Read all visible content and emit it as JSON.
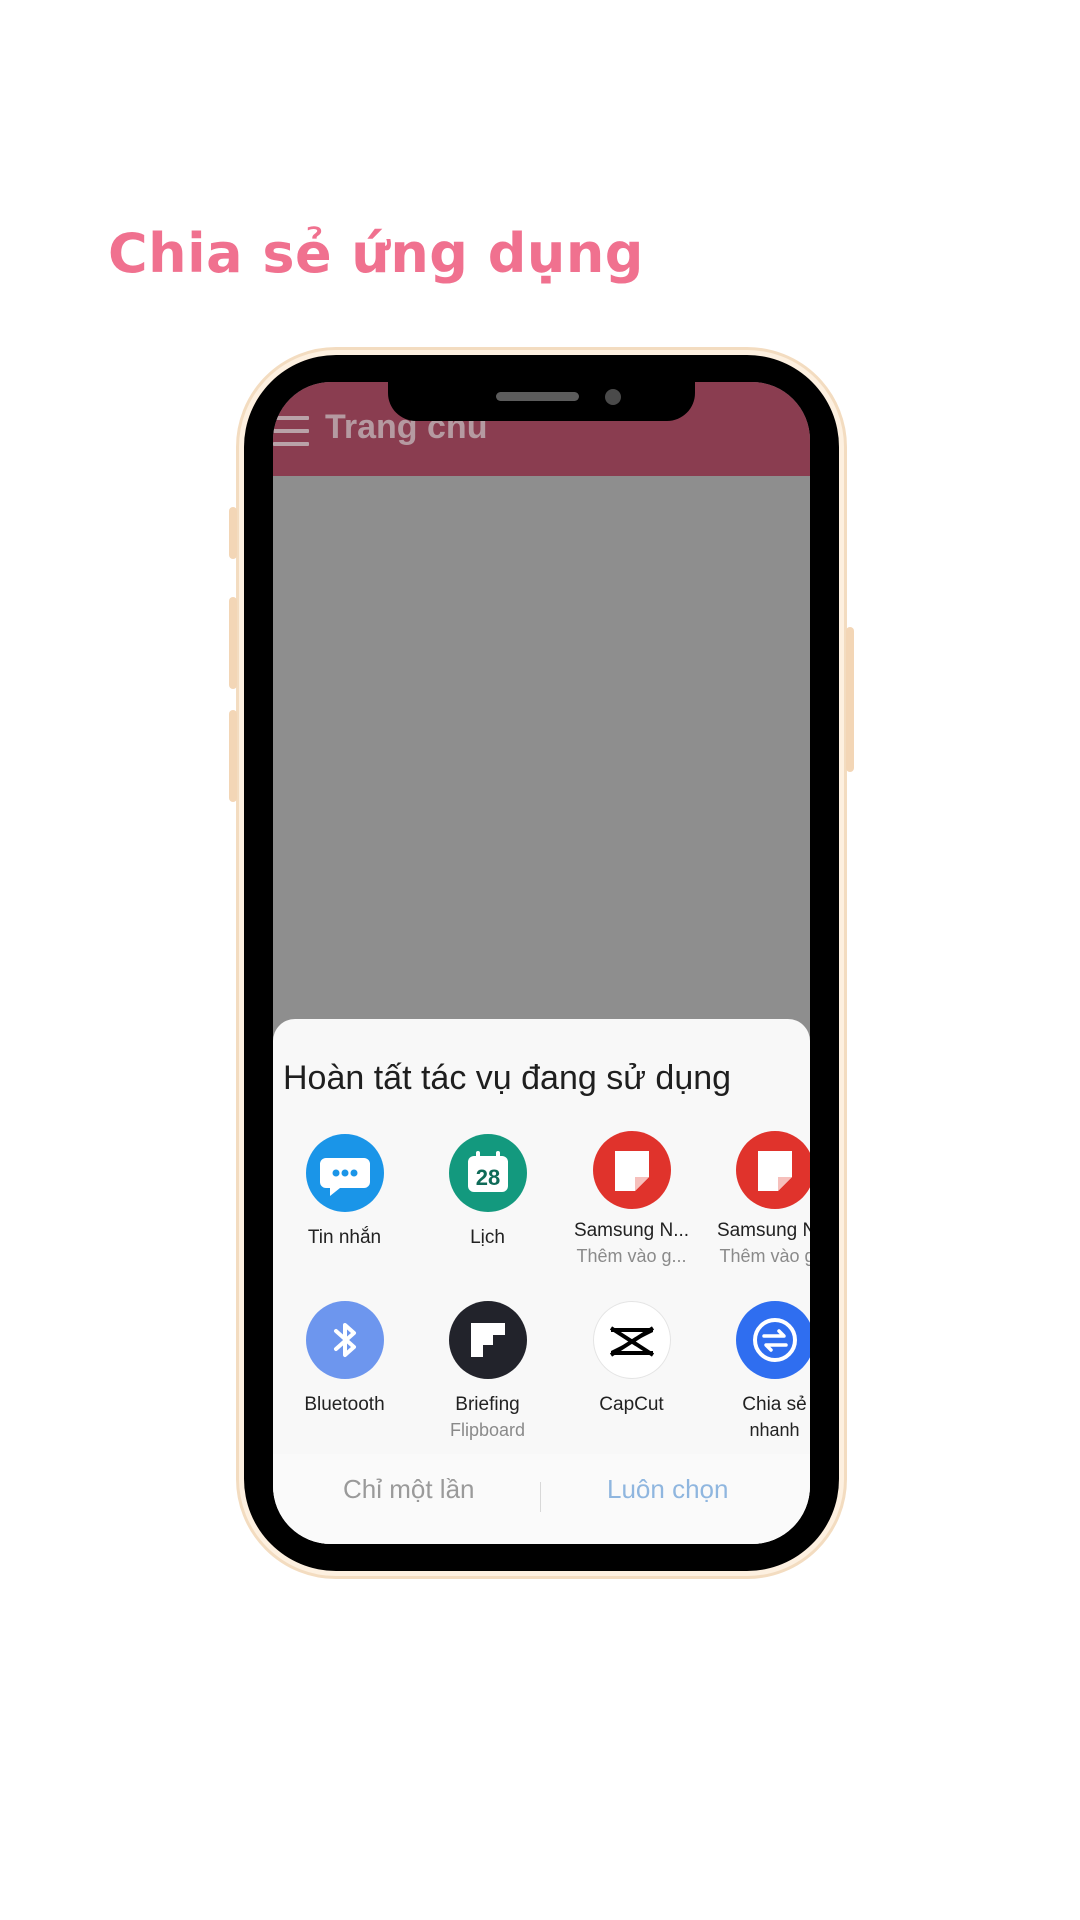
{
  "heading": "Chia sẻ ứng dụng",
  "app_bar": {
    "title": "Trang chủ"
  },
  "share_sheet": {
    "title": "Hoàn tất tác vụ đang sử dụng",
    "apps": [
      {
        "label": "Tin nhắn",
        "sub": ""
      },
      {
        "label": "Lịch",
        "sub": "",
        "badge": "28"
      },
      {
        "label": "Samsung N...",
        "sub": "Thêm vào g..."
      },
      {
        "label": "Samsung N...",
        "sub": "Thêm vào g..."
      },
      {
        "label": "Bluetooth",
        "sub": ""
      },
      {
        "label": "Briefing",
        "sub": "Flipboard"
      },
      {
        "label": "CapCut",
        "sub": ""
      },
      {
        "label": "Chia sẻ",
        "sub": "nhanh"
      }
    ],
    "actions": {
      "once": "Chỉ một lần",
      "always": "Luôn chọn"
    }
  },
  "colors": {
    "heading": "#f0718f",
    "app_bar": "#8a3d50",
    "always_action": "#8fb6df"
  }
}
